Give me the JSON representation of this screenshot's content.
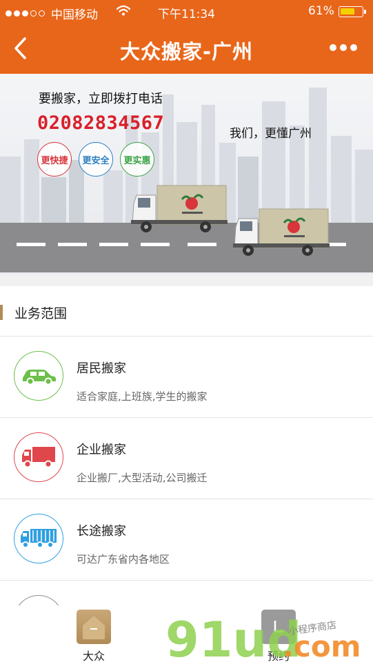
{
  "status_bar": {
    "carrier": "中国移动",
    "time": "下午11:34",
    "battery": "61%"
  },
  "nav": {
    "title": "大众搬家-广州"
  },
  "banner": {
    "cta": "要搬家，立即拨打电话",
    "phone": "02082834567",
    "slogan": "我们，更懂广州",
    "badges": [
      "更快捷",
      "更安全",
      "更实惠"
    ],
    "badge_colors": [
      "#d9343a",
      "#2a7fc1",
      "#3aa343"
    ]
  },
  "section": {
    "title": "业务范围"
  },
  "services": [
    {
      "name": "居民搬家",
      "desc": "适合家庭,上班族,学生的搬家",
      "icon": "car-icon",
      "color": "#6cc04a"
    },
    {
      "name": "企业搬家",
      "desc": "企业搬厂,大型活动,公司搬迁",
      "icon": "truck-icon",
      "color": "#e0474c"
    },
    {
      "name": "长途搬家",
      "desc": "可达广东省内各地区",
      "icon": "lorry-icon",
      "color": "#2f9fe0"
    }
  ],
  "tabbar": {
    "tabs": [
      {
        "label": "大众",
        "icon": "home-icon"
      },
      {
        "label": "预约",
        "icon": "calendar-icon"
      }
    ]
  },
  "watermark": {
    "brand_a": "91ud",
    "brand_b": ".com",
    "tagline": "小程序商店"
  },
  "colors": {
    "accent": "#e8661a",
    "phone_red": "#d9202a"
  }
}
